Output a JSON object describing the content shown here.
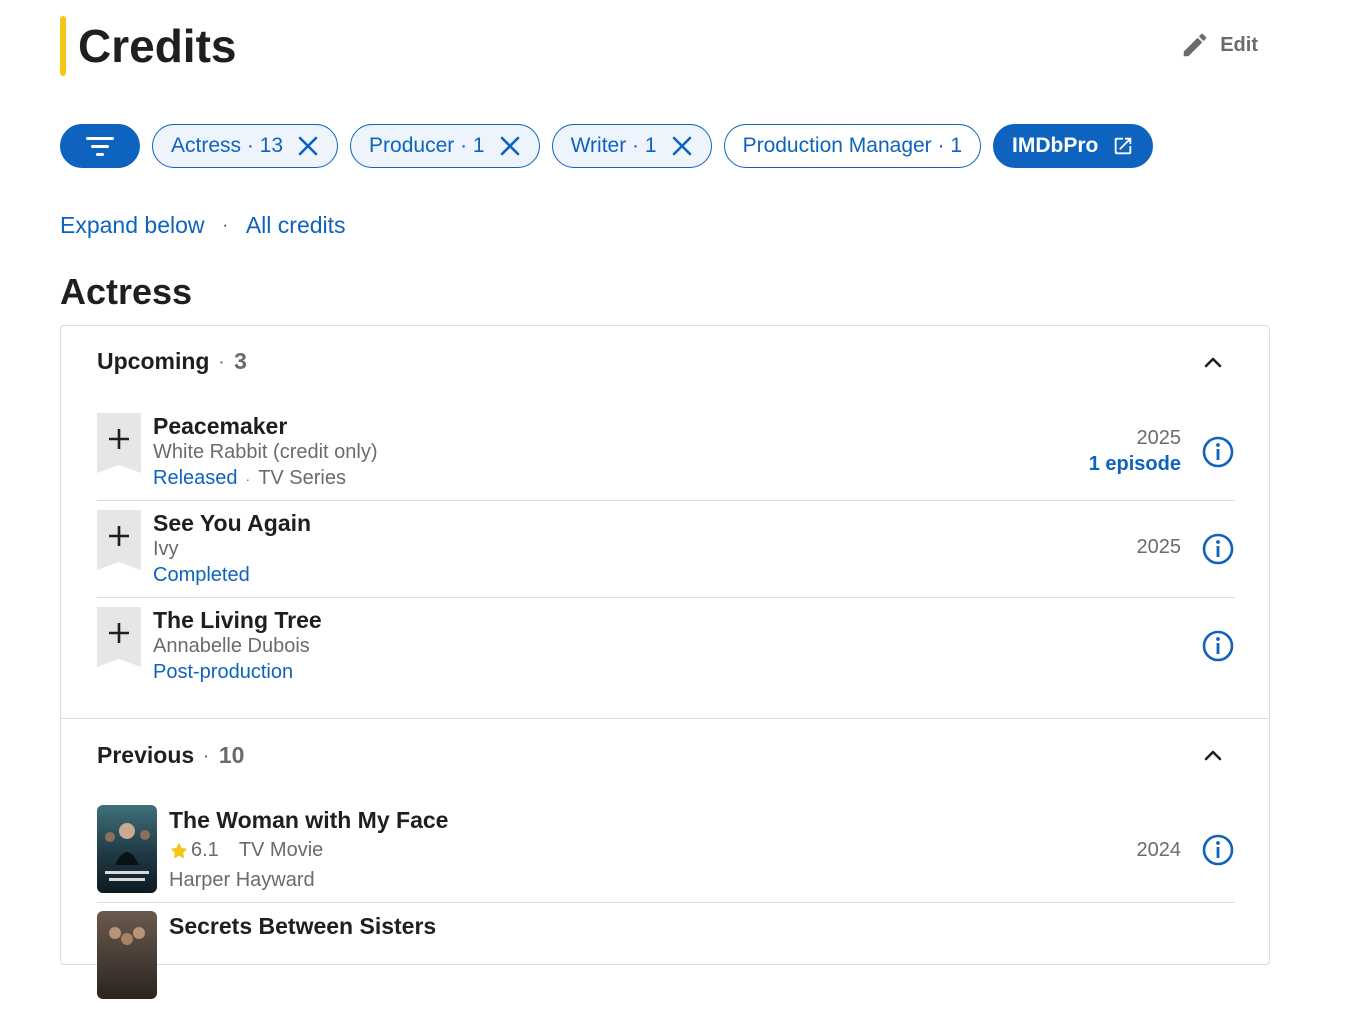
{
  "header": {
    "title": "Credits",
    "edit_label": "Edit"
  },
  "chips": [
    {
      "label": "Actress · 13"
    },
    {
      "label": "Producer · 1"
    },
    {
      "label": "Writer · 1"
    },
    {
      "label": "Production Manager · 1"
    },
    {
      "label": "IMDbPro"
    }
  ],
  "links": {
    "expand": "Expand below",
    "separator": "·",
    "all": "All credits"
  },
  "section": {
    "title": "Actress"
  },
  "upcoming": {
    "label": "Upcoming",
    "dot": "·",
    "count": "3",
    "items": [
      {
        "title": "Peacemaker",
        "role": "White Rabbit (credit only)",
        "status": "Released",
        "dot": "·",
        "type": "TV Series",
        "year": "2025",
        "episodes": "1 episode"
      },
      {
        "title": "See You Again",
        "role": "Ivy",
        "status": "Completed",
        "year": "2025"
      },
      {
        "title": "The Living Tree",
        "role": "Annabelle Dubois",
        "status": "Post-production"
      }
    ]
  },
  "previous": {
    "label": "Previous",
    "dot": "·",
    "count": "10",
    "items": [
      {
        "title": "The Woman with My Face",
        "rating": "6.1",
        "type": "TV Movie",
        "role": "Harper Hayward",
        "year": "2024"
      },
      {
        "title": "Secrets Between Sisters"
      }
    ]
  },
  "colors": {
    "accent": "#f5c518",
    "link": "#0e63be",
    "muted": "#6b6b6b"
  }
}
